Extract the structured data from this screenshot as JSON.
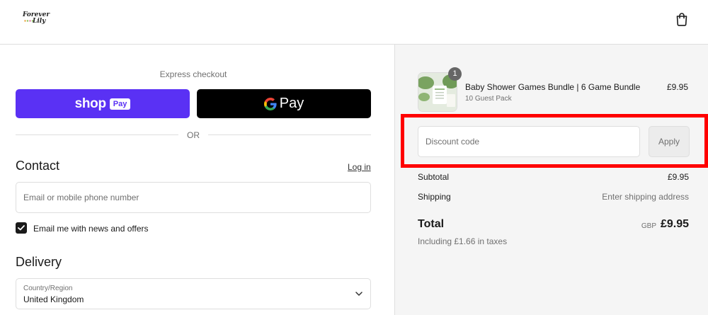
{
  "header": {
    "logo_line1": "Forever",
    "logo_line2": "Lily",
    "cart_icon": "shopping-bag-icon"
  },
  "express": {
    "label": "Express checkout",
    "shop_pay": {
      "word": "shop",
      "badge": "Pay",
      "color": "#5a31f4"
    },
    "google_pay": {
      "word": "Pay",
      "icon": "google-g-icon",
      "color": "#000000"
    },
    "divider_text": "OR"
  },
  "contact": {
    "heading": "Contact",
    "login_label": "Log in",
    "email_placeholder": "Email or mobile phone number",
    "email_value": "",
    "newsletter_label": "Email me with news and offers",
    "newsletter_checked": true
  },
  "delivery": {
    "heading": "Delivery",
    "country_label": "Country/Region",
    "country_value": "United Kingdom"
  },
  "summary": {
    "item": {
      "quantity": "1",
      "name": "Baby Shower Games Bundle | 6 Game Bundle",
      "variant": "10 Guest Pack",
      "price": "£9.95"
    },
    "discount": {
      "placeholder": "Discount code",
      "value": "",
      "apply_label": "Apply"
    },
    "subtotal_label": "Subtotal",
    "subtotal_value": "£9.95",
    "shipping_label": "Shipping",
    "shipping_value": "Enter shipping address",
    "total_label": "Total",
    "total_currency": "GBP",
    "total_value": "£9.95",
    "tax_note": "Including £1.66 in taxes"
  },
  "colors": {
    "highlight": "#ff0000",
    "panel_bg": "#f5f5f5"
  }
}
